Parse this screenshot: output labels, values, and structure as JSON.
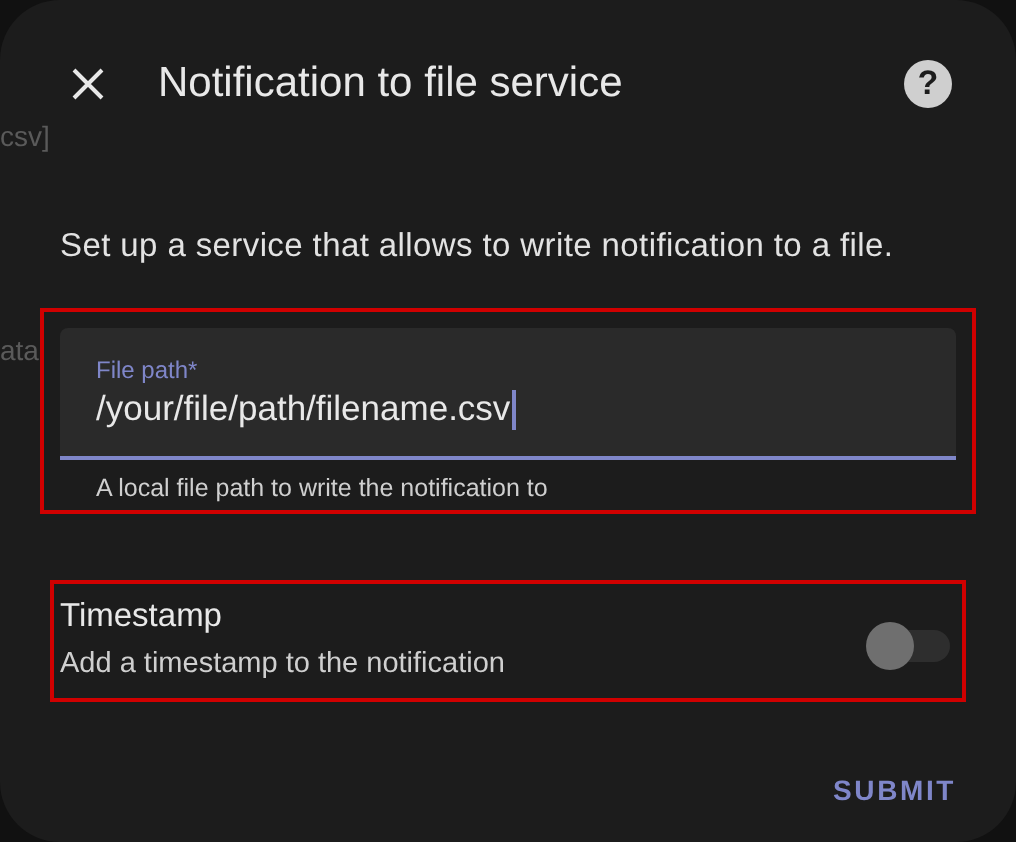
{
  "background_texts": [
    "csv]",
    "ata"
  ],
  "dialog": {
    "title": "Notification to file service",
    "help_icon": "?",
    "description": "Set up a service that allows to write notification to a file.",
    "file_path": {
      "label": "File path*",
      "value": "/your/file/path/filename.csv",
      "helper": "A local file path to write the notification to",
      "focused": true,
      "highlighted": true
    },
    "timestamp": {
      "label": "Timestamp",
      "description": "Add a timestamp to the notification",
      "on": false,
      "highlighted": true
    },
    "buttons": [
      "SUBMIT"
    ]
  }
}
